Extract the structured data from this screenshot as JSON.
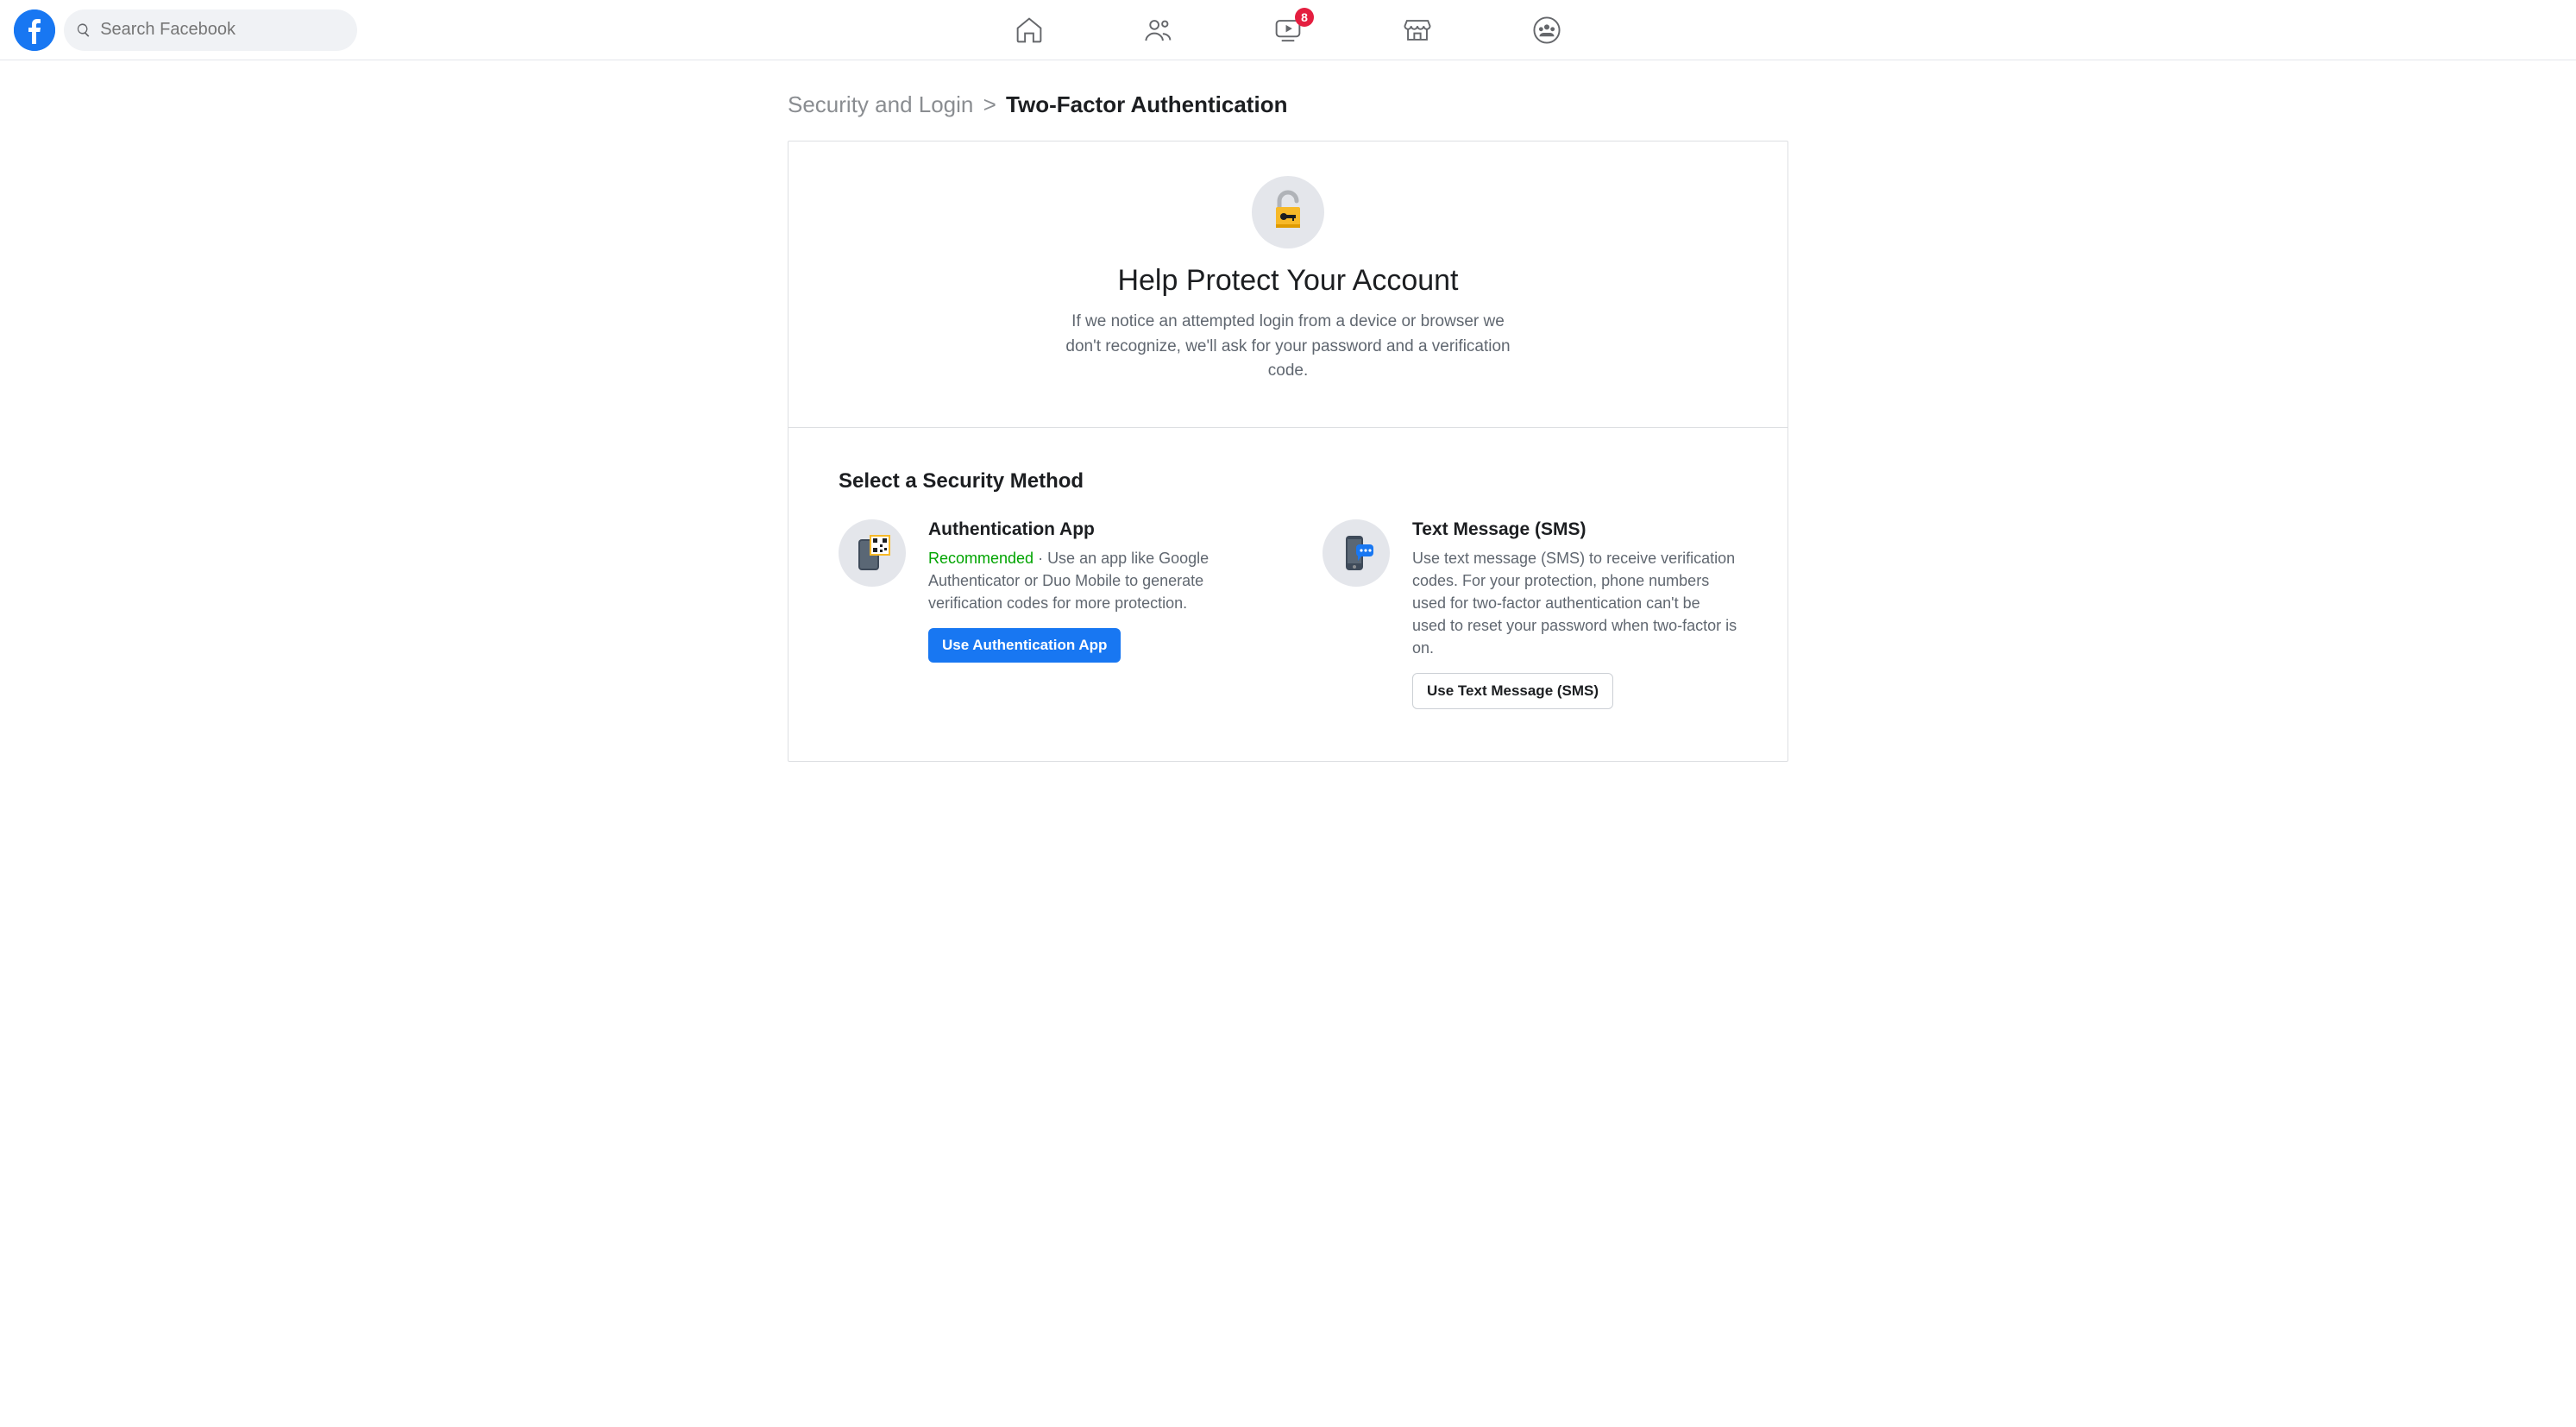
{
  "search": {
    "placeholder": "Search Facebook"
  },
  "nav": {
    "watch_badge": "8"
  },
  "breadcrumb": {
    "parent": "Security and Login",
    "sep": ">",
    "current": "Two-Factor Authentication"
  },
  "hero": {
    "title": "Help Protect Your Account",
    "desc": "If we notice an attempted login from a device or browser we don't recognize, we'll ask for your password and a verification code."
  },
  "section": {
    "title": "Select a Security Method"
  },
  "method_auth_app": {
    "title": "Authentication App",
    "recommended": "Recommended",
    "dot": " · ",
    "desc": "Use an app like Google Authenticator or Duo Mobile to generate verification codes for more protection.",
    "button": "Use Authentication App"
  },
  "method_sms": {
    "title": "Text Message (SMS)",
    "desc": "Use text message (SMS) to receive verification codes. For your protection, phone numbers used for two-factor authentication can't be used to reset your password when two-factor is on.",
    "button": "Use Text Message (SMS)"
  }
}
